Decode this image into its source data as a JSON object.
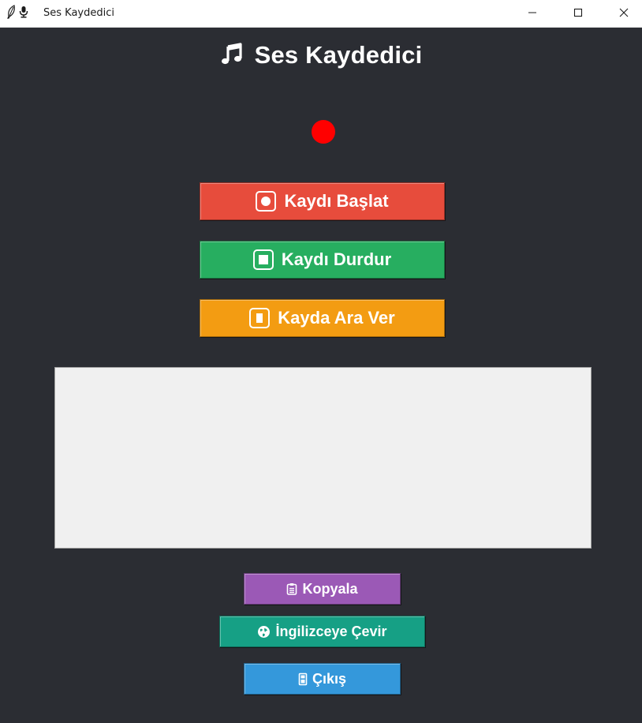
{
  "window": {
    "title": "Ses Kaydedici",
    "icons": [
      "feather-icon",
      "microphone-icon"
    ],
    "controls": [
      "minimize-icon",
      "maximize-icon",
      "close-icon"
    ]
  },
  "header": {
    "icon": "music-note-icon",
    "title": "Ses Kaydedici"
  },
  "status": {
    "indicator_color": "#ff0000"
  },
  "buttons": {
    "start": {
      "label": "Kaydı Başlat",
      "icon": "record-icon",
      "color": "#e74c3c"
    },
    "stop": {
      "label": "Kaydı Durdur",
      "icon": "stop-icon",
      "color": "#27ae60"
    },
    "pause": {
      "label": "Kayda Ara Ver",
      "icon": "pause-icon",
      "color": "#f39c12"
    },
    "copy": {
      "label": "Kopyala",
      "icon": "clipboard-icon",
      "color": "#9b59b6"
    },
    "translate": {
      "label": "İngilizceye Çevir",
      "icon": "globe-icon",
      "color": "#16a085"
    },
    "exit": {
      "label": "Çıkış",
      "icon": "door-icon",
      "color": "#3498db"
    }
  },
  "transcript": {
    "value": ""
  },
  "colors": {
    "background": "#2b2d33",
    "text_area": "#f0f0f0"
  }
}
